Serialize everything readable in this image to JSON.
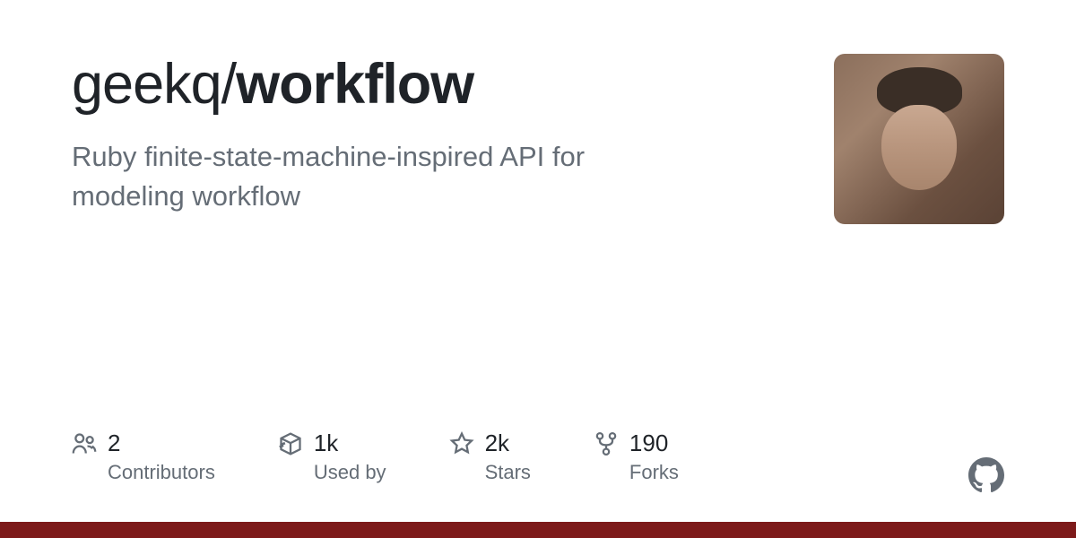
{
  "repo": {
    "owner": "geekq",
    "separator": "/",
    "name": "workflow",
    "description": "Ruby finite-state-machine-inspired API for modeling workflow"
  },
  "stats": {
    "contributors": {
      "value": "2",
      "label": "Contributors"
    },
    "usedby": {
      "value": "1k",
      "label": "Used by"
    },
    "stars": {
      "value": "2k",
      "label": "Stars"
    },
    "forks": {
      "value": "190",
      "label": "Forks"
    }
  }
}
